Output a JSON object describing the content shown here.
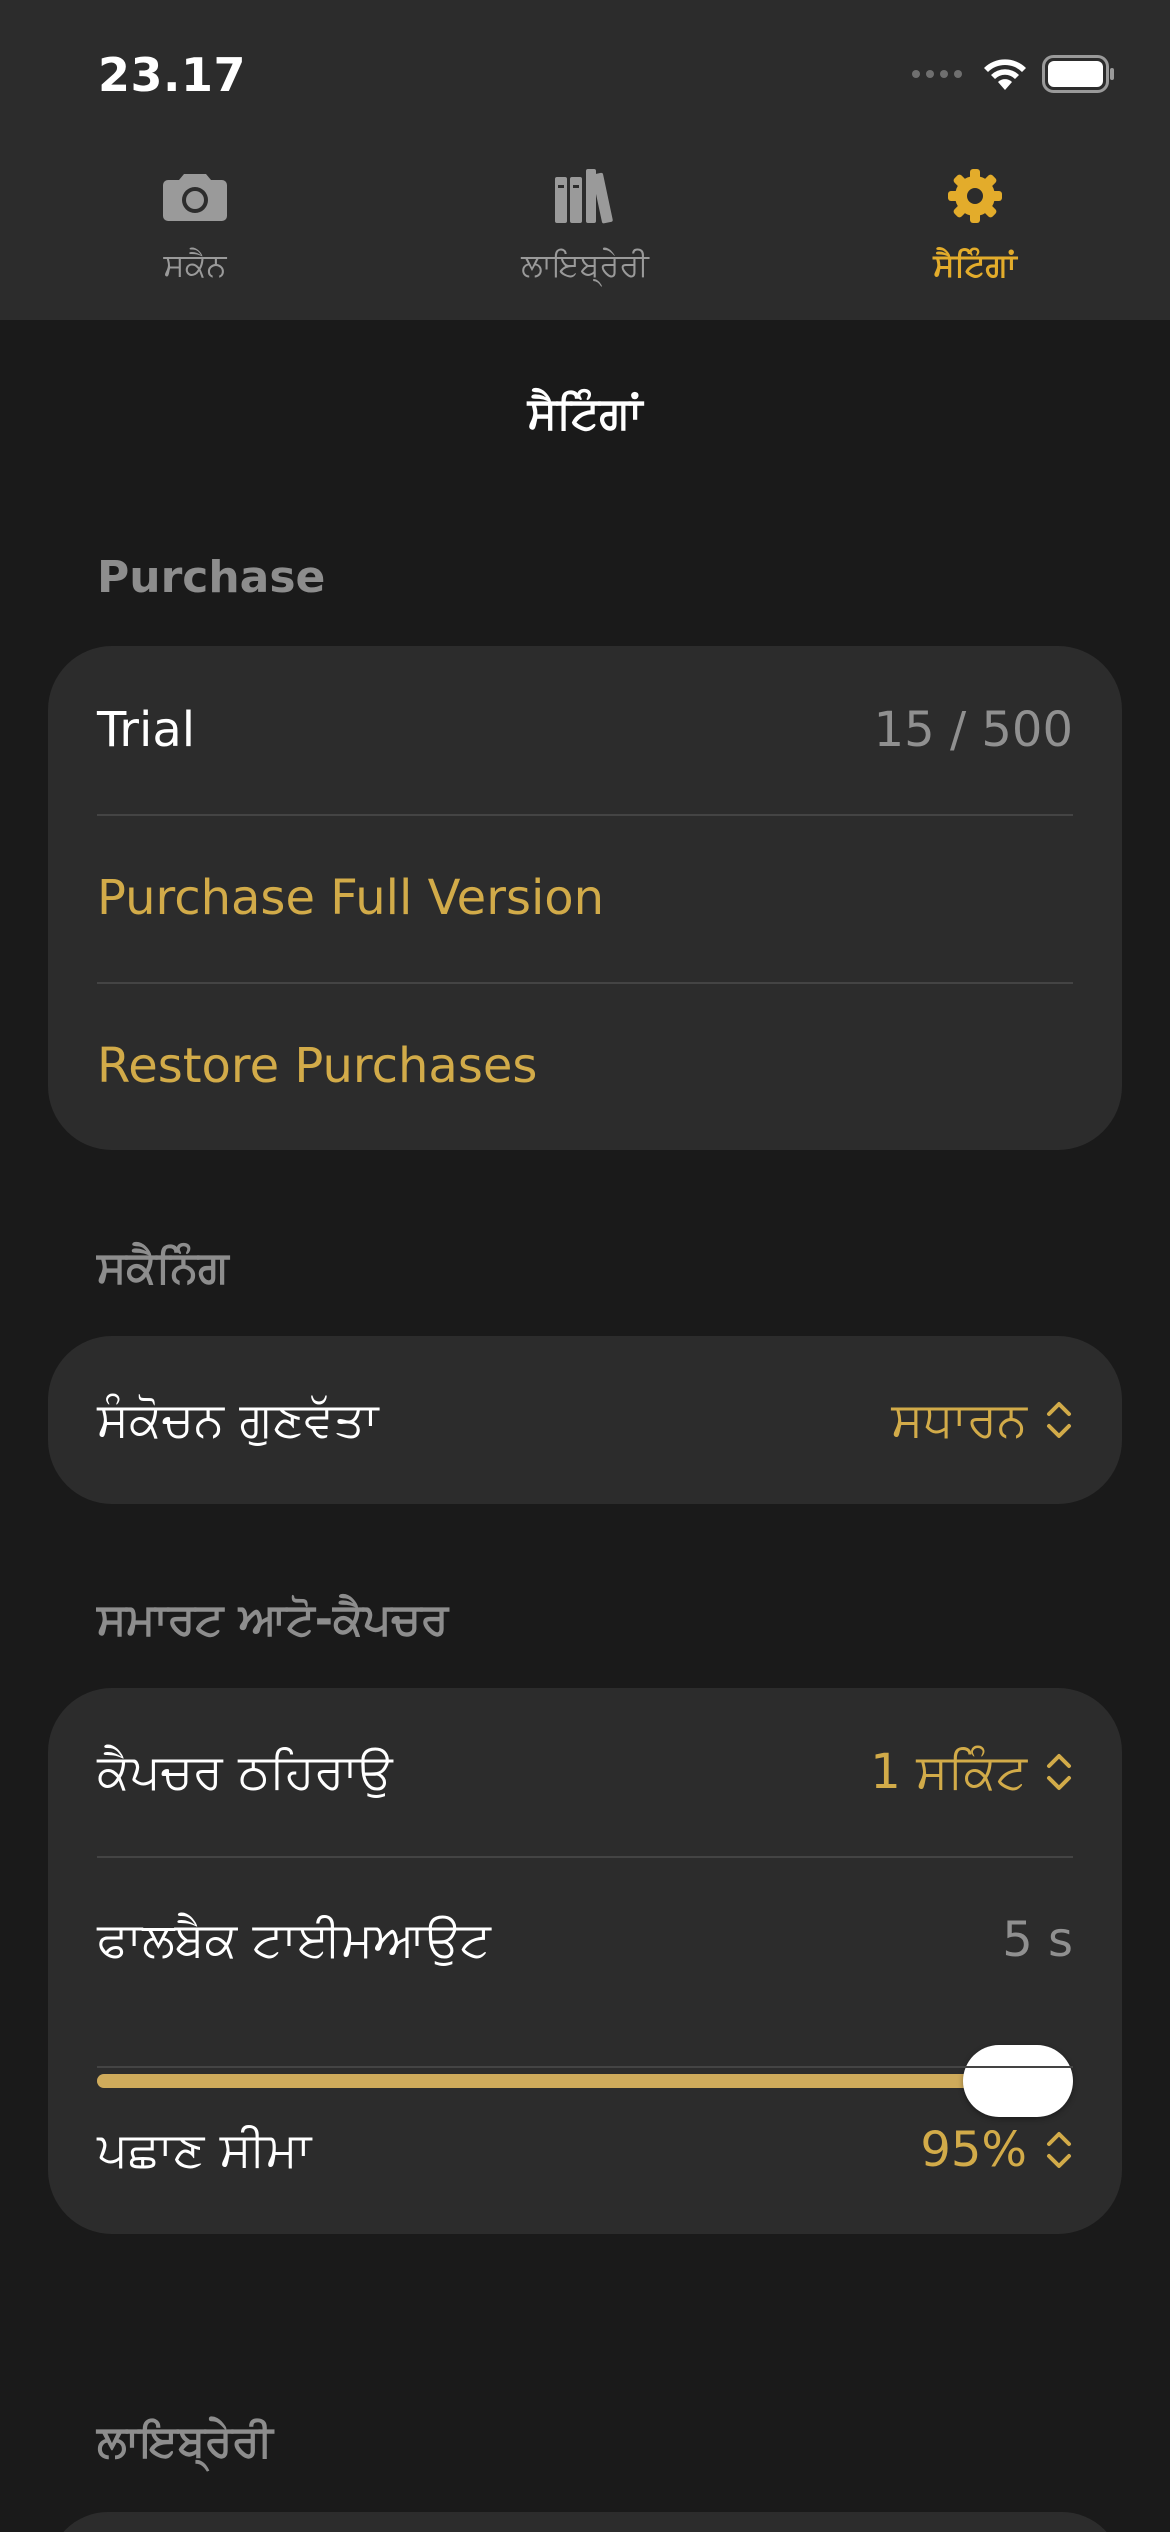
{
  "status_bar": {
    "time": "23.17"
  },
  "tabs": [
    {
      "label": "ਸਕੈਨ",
      "icon": "camera-icon",
      "active": false
    },
    {
      "label": "ਲਾਇਬ੍ਰੇਰੀ",
      "icon": "books-icon",
      "active": false
    },
    {
      "label": "ਸੈਟਿੰਗਾਂ",
      "icon": "gear-icon",
      "active": true
    }
  ],
  "page_title": "ਸੈਟਿੰਗਾਂ",
  "colors": {
    "accent": "#d2ab49",
    "tab_active": "#e3ac2b",
    "card": "#2c2c2c",
    "background": "#1a1a1a"
  },
  "purchase": {
    "header": "Purchase",
    "trial_label": "Trial",
    "trial_value": "15 / 500",
    "buy_label": "Purchase Full Version",
    "restore_label": "Restore Purchases"
  },
  "scanning": {
    "header": "ਸਕੈਨਿੰਗ",
    "compression_label": "ਸੰਕੋਚਨ ਗੁਣਵੱਤਾ",
    "compression_value": "ਸਧਾਰਨ"
  },
  "auto_capture": {
    "header": "ਸਮਾਰਟ ਆਟੋ-ਕੈਪਚਰ",
    "pause_label": "ਕੈਪਚਰ ਠਹਿਰਾਉ",
    "pause_value": "1 ਸਕਿੰਟ",
    "fallback_label": "ਫਾਲਬੈਕ ਟਾਈਮਆਉਟ",
    "fallback_value": "5 s",
    "fallback_slider_level": 1.0,
    "threshold_label": "ਪਛਾਣ ਸੀਮਾ",
    "threshold_value": "95%"
  },
  "library": {
    "header": "ਲਾਇਬ੍ਰੇਰੀ"
  }
}
